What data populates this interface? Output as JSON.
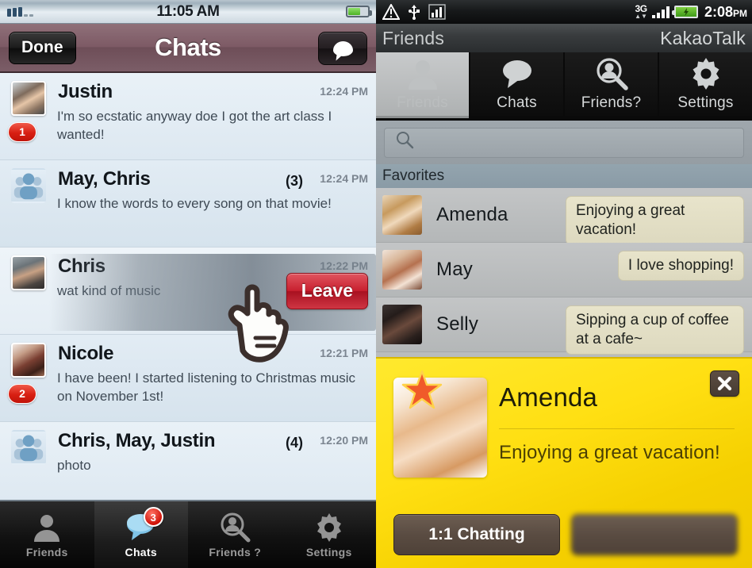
{
  "ios": {
    "status": {
      "time": "11:05 AM",
      "signal_icon": "signal-bars-icon",
      "battery_icon": "battery-icon"
    },
    "nav": {
      "done_label": "Done",
      "title": "Chats",
      "compose_icon": "compose-bubble-icon"
    },
    "chats": [
      {
        "name": "Justin",
        "time": "12:24 PM",
        "message": "I'm so ecstatic anyway doe I got the art class I wanted!",
        "badge": "1",
        "count": "",
        "avatar": "photo-justin",
        "group": false
      },
      {
        "name": "May, Chris",
        "time": "12:24 PM",
        "message": "I know the words to every song on that movie!",
        "badge": "",
        "count": "(3)",
        "avatar": "group-avatar",
        "group": true
      },
      {
        "name": "Chris",
        "time": "12:22 PM",
        "message": "wat kind of music",
        "badge": "",
        "count": "",
        "avatar": "photo-chris",
        "group": false,
        "swiped": true,
        "action_label": "Leave"
      },
      {
        "name": "Nicole",
        "time": "12:21 PM",
        "message": "I have been! I started listening to Christmas music on November 1st!",
        "badge": "2",
        "count": "",
        "avatar": "photo-nicole",
        "group": false
      },
      {
        "name": "Chris, May, Justin",
        "time": "12:20 PM",
        "message": "photo",
        "badge": "",
        "count": "(4)",
        "avatar": "group-avatar",
        "group": true
      }
    ],
    "tabs": [
      {
        "label": "Friends",
        "icon": "person-icon",
        "active": false,
        "badge": ""
      },
      {
        "label": "Chats",
        "icon": "chat-bubble-icon",
        "active": true,
        "badge": "3"
      },
      {
        "label": "Friends ?",
        "icon": "find-friends-icon",
        "active": false,
        "badge": ""
      },
      {
        "label": "Settings",
        "icon": "gear-icon",
        "active": false,
        "badge": ""
      }
    ]
  },
  "android": {
    "status": {
      "time": "2:08",
      "meridiem": "PM",
      "network": "3G",
      "icons": [
        "warning-triangle-icon",
        "usb-icon",
        "signal-chart-icon",
        "signal-bars-icon",
        "battery-charging-icon"
      ]
    },
    "title": {
      "left": "Friends",
      "right": "KakaoTalk"
    },
    "tabs": [
      {
        "label": "Friends",
        "icon": "person-icon",
        "active": true
      },
      {
        "label": "Chats",
        "icon": "chat-bubble-icon",
        "active": false
      },
      {
        "label": "Friends?",
        "icon": "find-friends-icon",
        "active": false
      },
      {
        "label": "Settings",
        "icon": "gear-icon",
        "active": false
      }
    ],
    "search": {
      "placeholder": "",
      "icon": "search-icon"
    },
    "section_header": "Favorites",
    "favorites": [
      {
        "name": "Amenda",
        "status": "Enjoying a great vacation!",
        "avatar": "photo-amenda"
      },
      {
        "name": "May",
        "status": "I love shopping!",
        "avatar": "photo-may"
      },
      {
        "name": "Selly",
        "status": "Sipping a cup of coffee at a cafe~",
        "avatar": "photo-selly"
      }
    ],
    "popup": {
      "name": "Amenda",
      "status": "Enjoying a great vacation!",
      "close_icon": "close-x-icon",
      "star_icon": "star-favorite-icon",
      "primary_button": "1:1 Chatting",
      "secondary_button": "",
      "avatar": "photo-amenda-large"
    }
  },
  "colors": {
    "ios_navbar": "#7d5a65",
    "leave_red": "#c8202f",
    "badge_red": "#d81f12",
    "popup_yellow": "#ffdf12",
    "popup_button_brown": "#5a4c42"
  }
}
